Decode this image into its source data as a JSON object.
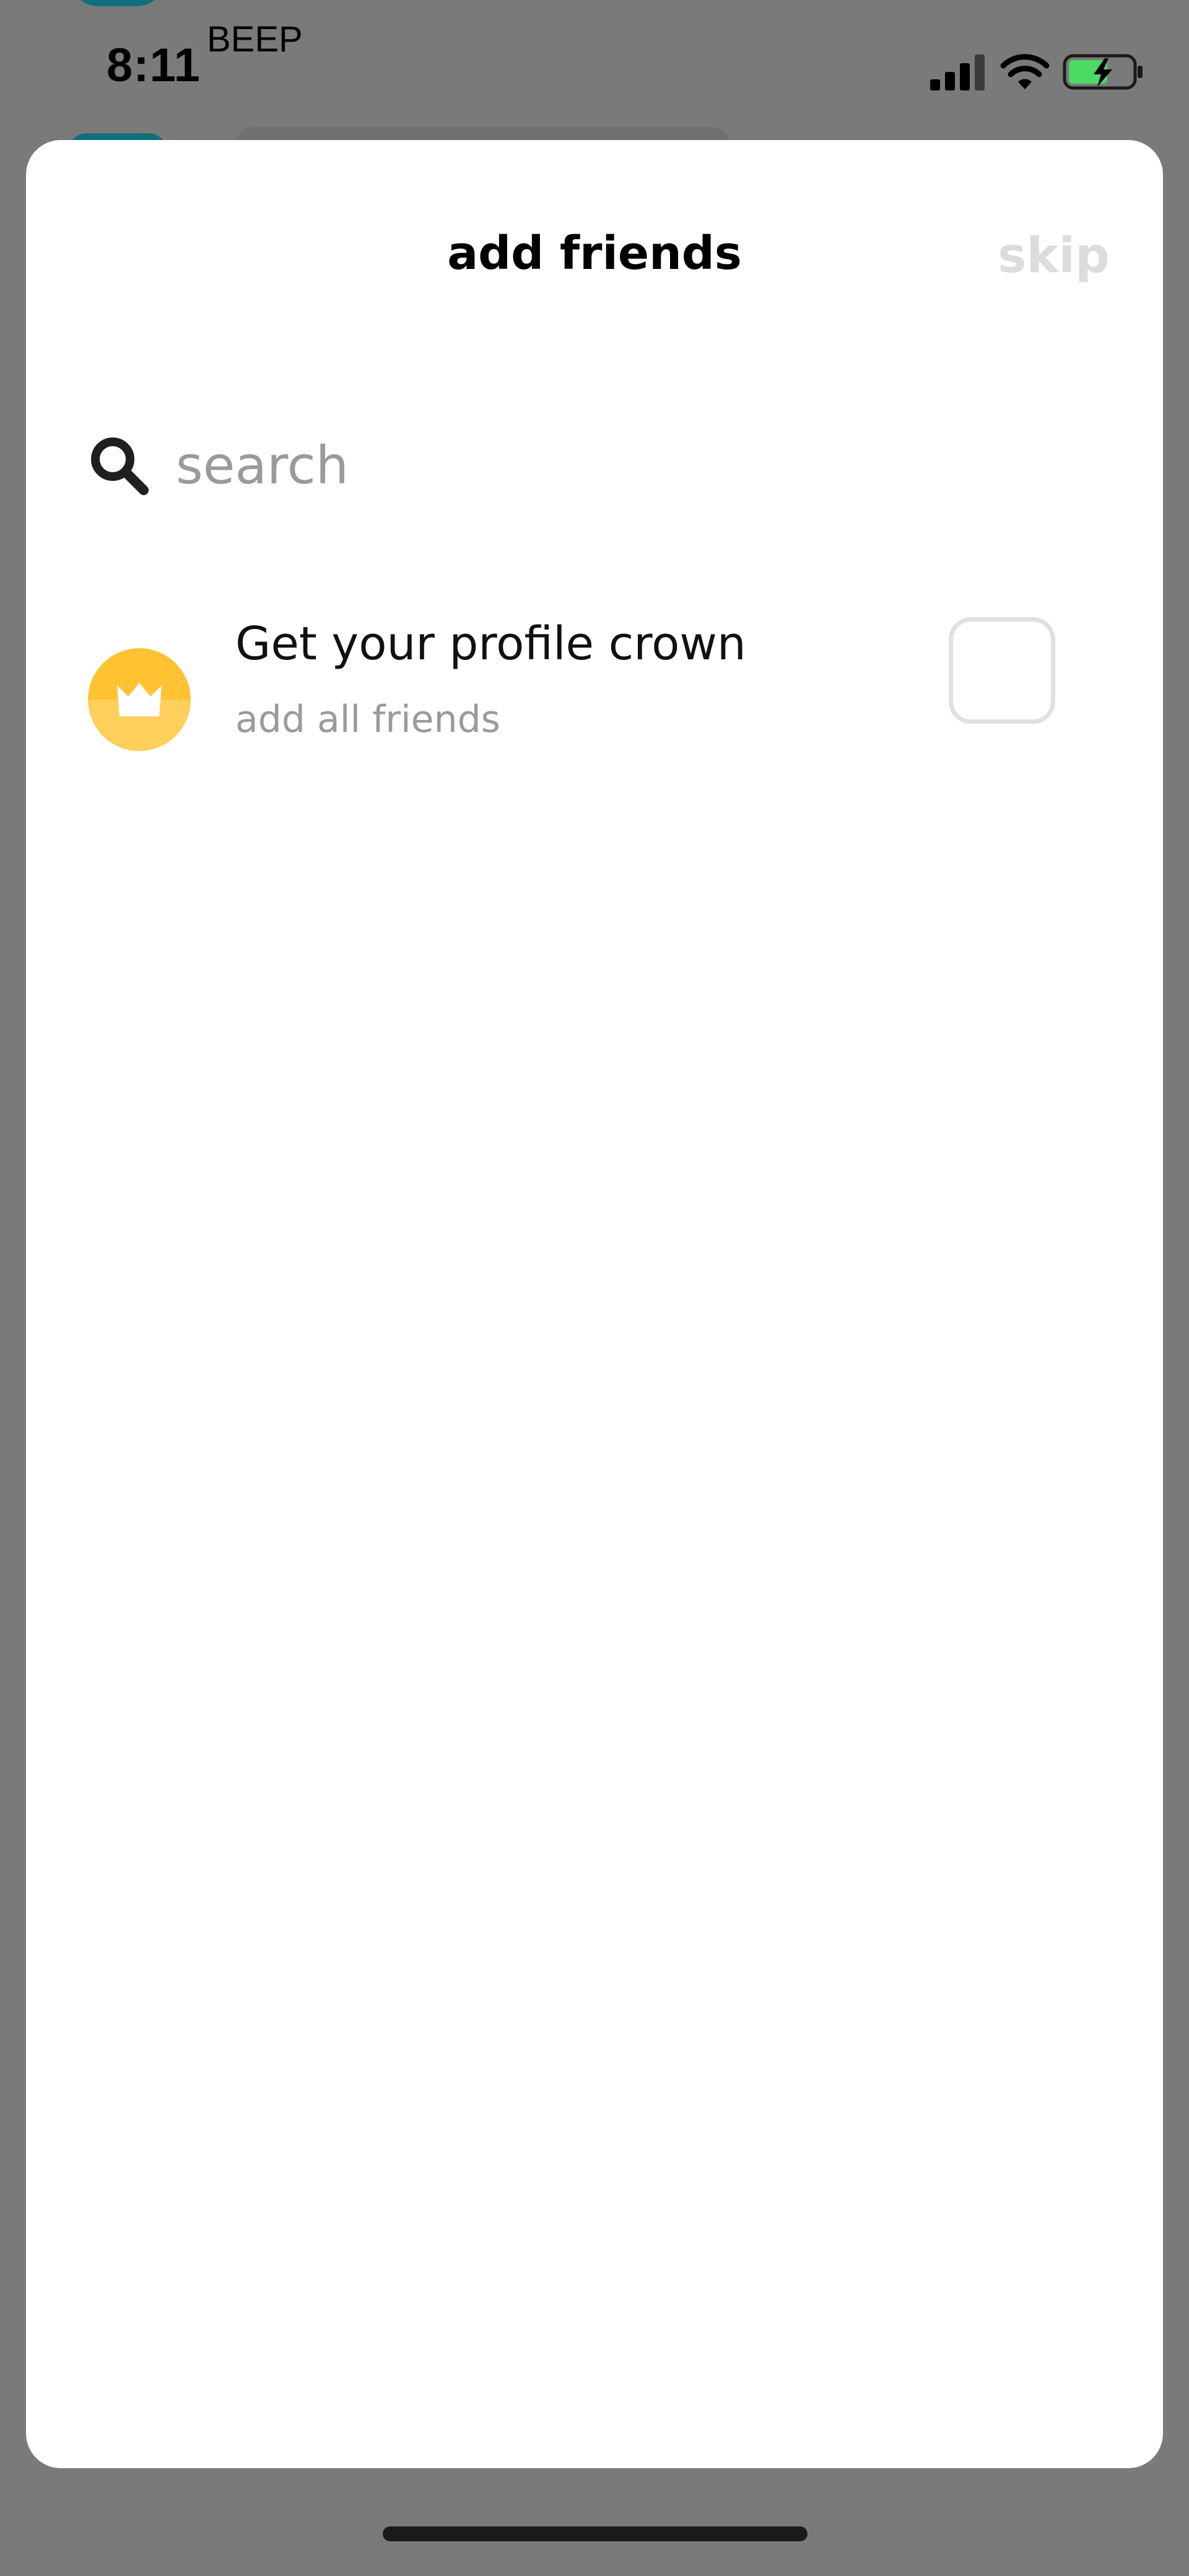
{
  "status_bar": {
    "time": "8:11",
    "carrier_label": "BEEP"
  },
  "sheet": {
    "title": "add friends",
    "skip_label": "skip"
  },
  "search": {
    "placeholder": "search",
    "value": ""
  },
  "crown_item": {
    "title": "Get your profile crown",
    "subtitle": "add all friends",
    "checked": false,
    "icon": "crown-icon"
  },
  "colors": {
    "crown_yellow": "#ffc233",
    "skip_disabled": "#dcdcdc",
    "subtitle_gray": "#9a9a9a",
    "battery_green": "#4cd964"
  }
}
